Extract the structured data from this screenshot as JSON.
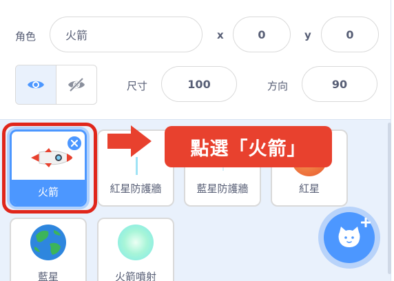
{
  "sprite_info": {
    "name_label": "角色",
    "name_value": "火箭",
    "x_label": "x",
    "x_value": "0",
    "y_label": "y",
    "y_value": "0",
    "size_label": "尺寸",
    "size_value": "100",
    "direction_label": "方向",
    "direction_value": "90"
  },
  "sprites": [
    {
      "label": "火箭",
      "selected": true
    },
    {
      "label": "紅星防護牆"
    },
    {
      "label": "藍星防護牆"
    },
    {
      "label": "紅星"
    },
    {
      "label": "藍星"
    },
    {
      "label": "火箭噴射"
    }
  ],
  "callout": {
    "text": "點選「火箭」"
  },
  "colors": {
    "accent": "#4c97ff",
    "callout_red": "#e8412e",
    "highlight_red": "#e0261b",
    "panel_bg": "#e9f1fc"
  },
  "icons": [
    "eye-icon",
    "eye-hidden-icon",
    "close-icon",
    "cat-icon",
    "plus-icon",
    "arrow-right-icon"
  ]
}
